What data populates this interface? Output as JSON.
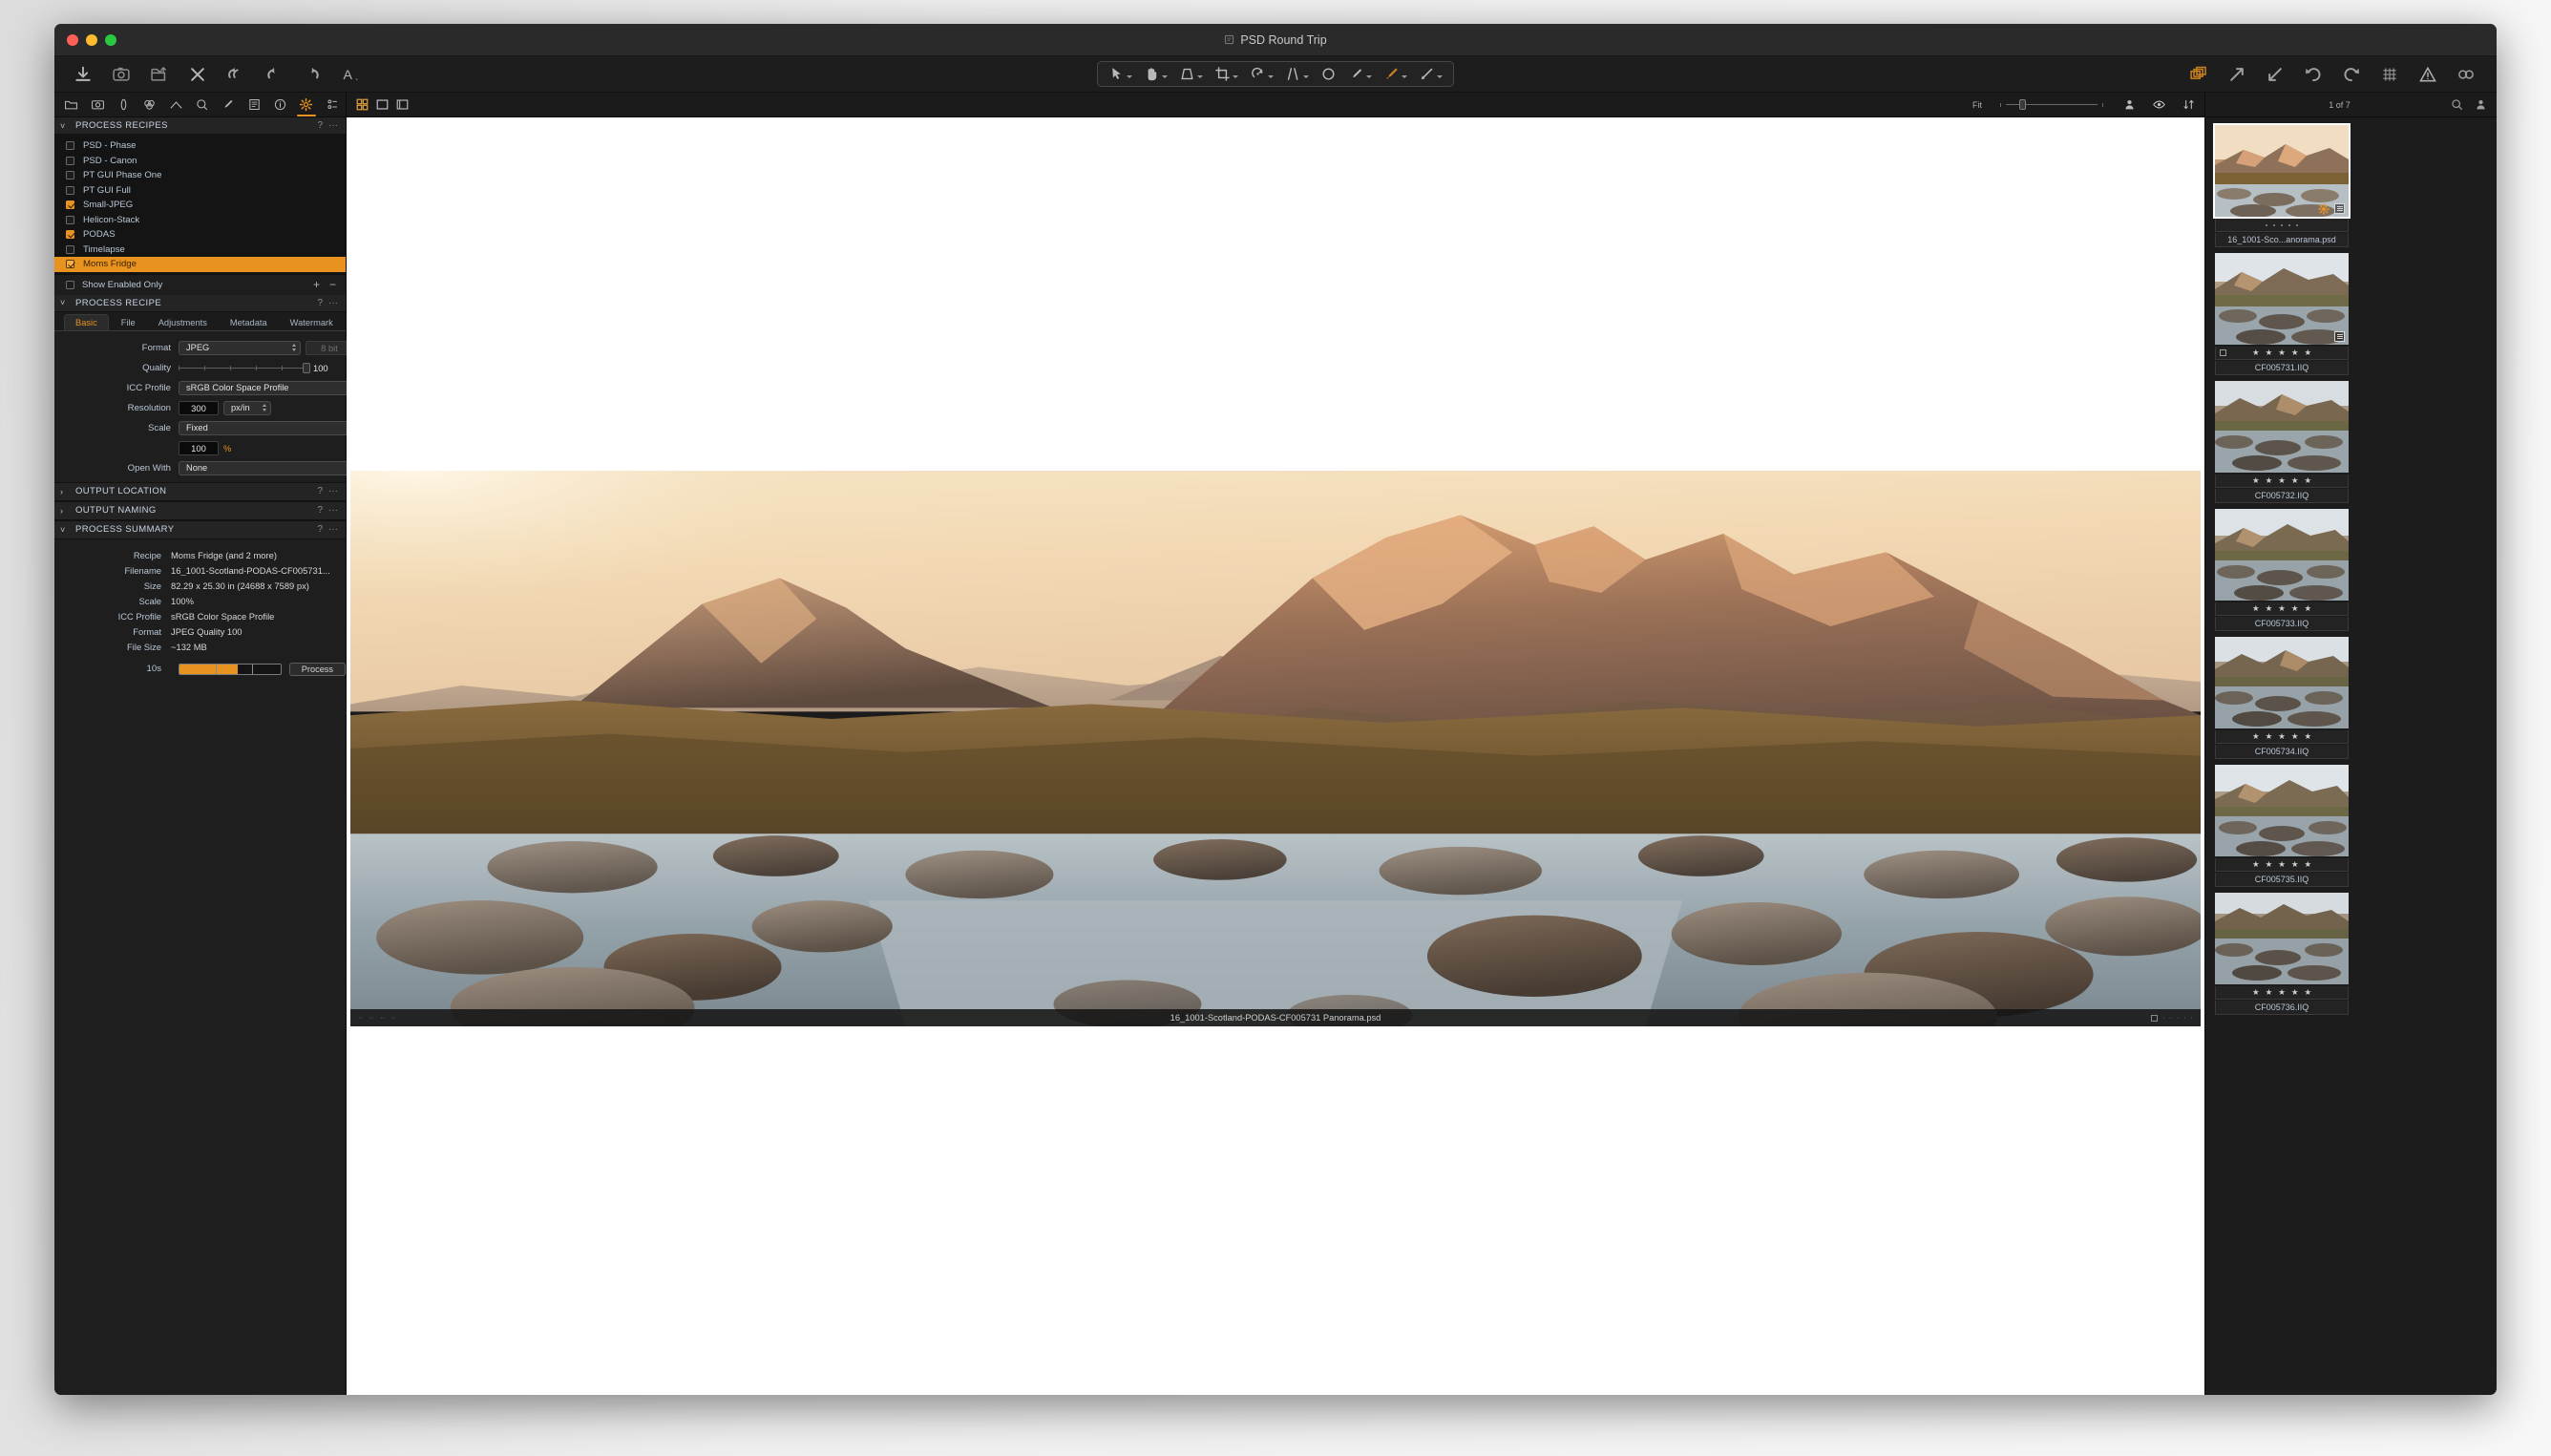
{
  "window": {
    "title": "PSD Round Trip"
  },
  "toolbar": {
    "left_icons": [
      "import-icon",
      "capture-icon",
      "export-folder-icon",
      "close-icon",
      "undo-all-icon",
      "undo-icon",
      "redo-icon",
      "text-tool-icon"
    ],
    "center_tools": [
      "pointer-tool",
      "pan-tool",
      "keystone-tool",
      "crop-tool",
      "rotate-tool",
      "straighten-tool",
      "spot-removal-tool",
      "draw-mask-tool",
      "color-picker-tool",
      "gradient-tool"
    ],
    "right_icons": [
      "variants-icon",
      "arrow-out-icon",
      "arrow-in-icon",
      "rotate-left-icon",
      "rotate-right-icon",
      "grid-icon",
      "warning-icon",
      "lens-icon"
    ]
  },
  "left_panel": {
    "tool_tabs": [
      "library-icon",
      "capture-icon",
      "lens-icon",
      "color-icon",
      "exposure-icon",
      "details-icon",
      "adjustments-icon",
      "metadata-icon",
      "info-icon",
      "output-icon",
      "batch-icon"
    ],
    "process_recipes": {
      "title": "PROCESS RECIPES",
      "help_label": "?",
      "menu_label": "···",
      "items": [
        {
          "name": "PSD - Phase",
          "checked": false,
          "selected": false
        },
        {
          "name": "PSD - Canon",
          "checked": false,
          "selected": false
        },
        {
          "name": "PT GUI Phase One",
          "checked": false,
          "selected": false
        },
        {
          "name": "PT GUI Full",
          "checked": false,
          "selected": false
        },
        {
          "name": "Small-JPEG",
          "checked": true,
          "selected": false
        },
        {
          "name": "Helicon-Stack",
          "checked": false,
          "selected": false
        },
        {
          "name": "PODAS",
          "checked": true,
          "selected": false
        },
        {
          "name": "Timelapse",
          "checked": false,
          "selected": false
        },
        {
          "name": "Moms Fridge",
          "checked": true,
          "selected": true
        }
      ],
      "show_enabled_only": "Show Enabled Only",
      "add_label": "+",
      "remove_label": "−"
    },
    "process_recipe": {
      "title": "PROCESS RECIPE",
      "help_label": "?",
      "menu_label": "···",
      "tabs": [
        "Basic",
        "File",
        "Adjustments",
        "Metadata",
        "Watermark"
      ],
      "active_tab": "Basic",
      "fields": {
        "format_label": "Format",
        "format_value": "JPEG",
        "bitdepth_value": "8 bit",
        "quality_label": "Quality",
        "quality_value": "100",
        "icc_label": "ICC Profile",
        "icc_value": "sRGB Color Space Profile",
        "resolution_label": "Resolution",
        "resolution_value": "300",
        "resolution_unit": "px/in",
        "scale_label": "Scale",
        "scale_value": "Fixed",
        "scale_percent": "100",
        "scale_percent_unit": "%",
        "openwith_label": "Open With",
        "openwith_value": "None"
      }
    },
    "output_location": {
      "title": "OUTPUT LOCATION",
      "help_label": "?",
      "menu_label": "···"
    },
    "output_naming": {
      "title": "OUTPUT NAMING",
      "help_label": "?",
      "menu_label": "···"
    },
    "process_summary": {
      "title": "PROCESS SUMMARY",
      "help_label": "?",
      "menu_label": "···",
      "rows": [
        {
          "key": "Recipe",
          "value": "Moms Fridge (and 2 more)"
        },
        {
          "key": "Filename",
          "value": "16_1001-Scotland-PODAS-CF005731..."
        },
        {
          "key": "Size",
          "value": "82.29 x 25.30 in (24688 x 7589 px)"
        },
        {
          "key": "Scale",
          "value": "100%"
        },
        {
          "key": "ICC Profile",
          "value": "sRGB Color Space Profile"
        },
        {
          "key": "Format",
          "value": "JPEG Quality 100"
        },
        {
          "key": "File Size",
          "value": "~132 MB"
        }
      ],
      "elapsed": "10s",
      "progress_percent": 58,
      "process_button": "Process"
    }
  },
  "viewer": {
    "view_mode_icons": [
      "grid-view-icon",
      "single-view-icon",
      "filmstrip-view-icon"
    ],
    "fit_label": "Fit",
    "zoom_percent": 18,
    "right_icons": [
      "person-icon",
      "eye-icon",
      "sort-icon"
    ],
    "caption": "16_1001-Scotland-PODAS-CF005731 Panorama.psd"
  },
  "browser": {
    "count_label": "1 of 7",
    "icons": [
      "search-icon",
      "person-icon"
    ],
    "thumbnails": [
      {
        "filename": "16_1001-Sco...anorama.psd",
        "rating": 0,
        "dots": 5,
        "selected": true,
        "has_gear": true,
        "has_doc": true,
        "scene": "pano"
      },
      {
        "filename": "CF005731.IIQ",
        "rating": 5,
        "dots": 0,
        "selected": false,
        "has_gear": false,
        "has_doc": true,
        "scene": "wide"
      },
      {
        "filename": "CF005732.IIQ",
        "rating": 5,
        "dots": 0,
        "selected": false,
        "has_gear": false,
        "has_doc": false,
        "scene": "mid"
      },
      {
        "filename": "CF005733.IIQ",
        "rating": 5,
        "dots": 0,
        "selected": false,
        "has_gear": false,
        "has_doc": false,
        "scene": "mid"
      },
      {
        "filename": "CF005734.IIQ",
        "rating": 5,
        "dots": 0,
        "selected": false,
        "has_gear": false,
        "has_doc": false,
        "scene": "mid"
      },
      {
        "filename": "CF005735.IIQ",
        "rating": 5,
        "dots": 0,
        "selected": false,
        "has_gear": false,
        "has_doc": false,
        "scene": "mid"
      },
      {
        "filename": "CF005736.IIQ",
        "rating": 5,
        "dots": 0,
        "selected": false,
        "has_gear": false,
        "has_doc": false,
        "scene": "tall"
      }
    ]
  },
  "colors": {
    "accent": "#e8921f",
    "panel_bg": "#1e1e1e",
    "label_blue": "#b9c7d6"
  }
}
